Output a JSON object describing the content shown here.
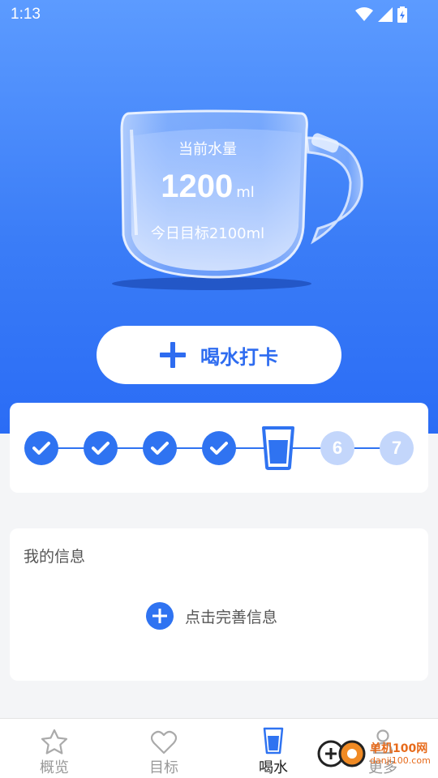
{
  "status_bar": {
    "time": "1:13"
  },
  "cup": {
    "label": "当前水量",
    "amount": "1200",
    "unit": "ml",
    "goal": "今日目标2100ml"
  },
  "checkin_button": {
    "label": "喝水打卡"
  },
  "progress": {
    "steps": [
      {
        "state": "done"
      },
      {
        "state": "done"
      },
      {
        "state": "done"
      },
      {
        "state": "done"
      },
      {
        "state": "current"
      },
      {
        "state": "todo",
        "label": "6"
      },
      {
        "state": "todo",
        "label": "7"
      }
    ]
  },
  "info": {
    "title": "我的信息",
    "action": "点击完善信息"
  },
  "tabs": [
    {
      "label": "概览",
      "icon": "star-icon"
    },
    {
      "label": "目标",
      "icon": "heart-icon"
    },
    {
      "label": "喝水",
      "icon": "water-glass-icon"
    },
    {
      "label": "更多",
      "icon": "person-icon"
    }
  ],
  "watermark": {
    "text": "单机100网",
    "sub": "danji100.com"
  },
  "colors": {
    "accent": "#2f73f1",
    "hero_top": "#5c9bff",
    "hero_bottom": "#2a6cf5"
  }
}
